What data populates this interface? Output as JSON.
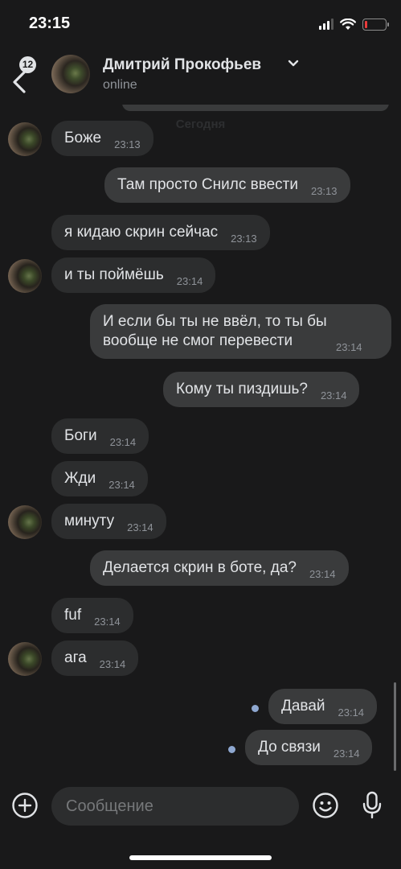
{
  "status_bar": {
    "time": "23:15"
  },
  "header": {
    "back_badge": "12",
    "contact_name": "Дмитрий Прокофьев",
    "contact_status": "online"
  },
  "chat": {
    "date_separator": "Сегодня",
    "messages": [
      {
        "dir": "in",
        "text": "Боже",
        "time": "23:13"
      },
      {
        "dir": "out",
        "text": "Там просто Снилс ввести",
        "time": "23:13"
      },
      {
        "dir": "in",
        "text": "я кидаю скрин сейчас",
        "time": "23:13"
      },
      {
        "dir": "in",
        "text": "и ты поймёшь",
        "time": "23:14"
      },
      {
        "dir": "out",
        "text": "И если бы ты не ввёл, то ты бы вообще не смог перевести",
        "time": "23:14"
      },
      {
        "dir": "out",
        "text": "Кому ты пиздишь?",
        "time": "23:14"
      },
      {
        "dir": "in",
        "text": "Боги",
        "time": "23:14"
      },
      {
        "dir": "in",
        "text": "Жди",
        "time": "23:14"
      },
      {
        "dir": "in",
        "text": "минуту",
        "time": "23:14"
      },
      {
        "dir": "out",
        "text": "Делается скрин в боте, да?",
        "time": "23:14"
      },
      {
        "dir": "in",
        "text": "fuf",
        "time": "23:14"
      },
      {
        "dir": "in",
        "text": "ага",
        "time": "23:14"
      },
      {
        "dir": "out",
        "text": "Давай",
        "time": "23:14",
        "unread": true
      },
      {
        "dir": "out",
        "text": "До связи",
        "time": "23:14",
        "unread": true
      }
    ]
  },
  "input": {
    "placeholder": "Сообщение"
  },
  "icons": {
    "back": "chevron-left-icon",
    "dropdown": "chevron-down-icon",
    "attach": "plus-circle-icon",
    "emoji": "smile-icon",
    "voice": "microphone-icon"
  },
  "colors": {
    "background": "#19191a",
    "incoming_bubble": "#2c2d2e",
    "outgoing_bubble": "#3a3b3c",
    "unread_dot": "#8ea7d0",
    "battery_low": "#eb3b3b"
  }
}
